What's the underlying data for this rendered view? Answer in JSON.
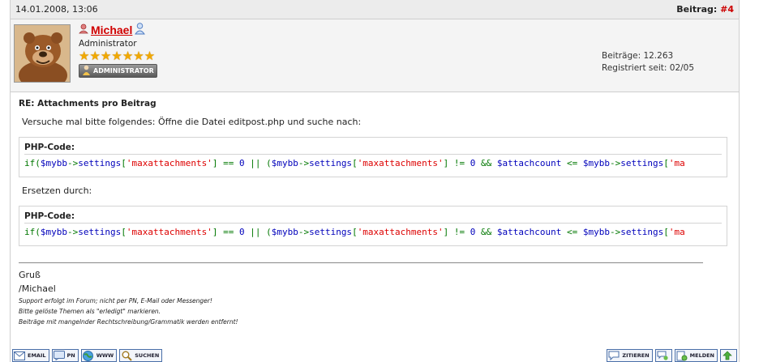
{
  "post": {
    "date": "14.01.2008, 13:06",
    "label": "Beitrag:",
    "number": "#4"
  },
  "author": {
    "name": "Michael",
    "title": "Administrator",
    "stars": 7,
    "badge": "ADMINISTRATOR",
    "posts": "Beiträge: 12.263",
    "registered": "Registriert seit: 02/05"
  },
  "message": {
    "subject": "RE: Attachments pro Beitrag",
    "intro": "Versuche mal bitte folgendes: Öffne die Datei editpost.php und suche nach:",
    "code_title_1": "PHP-Code:",
    "replace_text": "Ersetzen durch:",
    "code_title_2": "PHP-Code:",
    "code_line_1": [
      {
        "t": "if(",
        "c": "c-green"
      },
      {
        "t": "$mybb",
        "c": "c-blue"
      },
      {
        "t": "->",
        "c": "c-green"
      },
      {
        "t": "settings",
        "c": "c-blue"
      },
      {
        "t": "[",
        "c": "c-green"
      },
      {
        "t": "'maxattachments'",
        "c": "c-red"
      },
      {
        "t": "] == ",
        "c": "c-green"
      },
      {
        "t": "0 ",
        "c": "c-blue"
      },
      {
        "t": "|| (",
        "c": "c-green"
      },
      {
        "t": "$mybb",
        "c": "c-blue"
      },
      {
        "t": "->",
        "c": "c-green"
      },
      {
        "t": "settings",
        "c": "c-blue"
      },
      {
        "t": "[",
        "c": "c-green"
      },
      {
        "t": "'maxattachments'",
        "c": "c-red"
      },
      {
        "t": "] != ",
        "c": "c-green"
      },
      {
        "t": "0 ",
        "c": "c-blue"
      },
      {
        "t": "&& ",
        "c": "c-green"
      },
      {
        "t": "$attachcount ",
        "c": "c-blue"
      },
      {
        "t": "<= ",
        "c": "c-green"
      },
      {
        "t": "$mybb",
        "c": "c-blue"
      },
      {
        "t": "->",
        "c": "c-green"
      },
      {
        "t": "settings",
        "c": "c-blue"
      },
      {
        "t": "[",
        "c": "c-green"
      },
      {
        "t": "'ma",
        "c": "c-red"
      }
    ],
    "code_line_2": [
      {
        "t": "if(",
        "c": "c-green"
      },
      {
        "t": "$mybb",
        "c": "c-blue"
      },
      {
        "t": "->",
        "c": "c-green"
      },
      {
        "t": "settings",
        "c": "c-blue"
      },
      {
        "t": "[",
        "c": "c-green"
      },
      {
        "t": "'maxattachments'",
        "c": "c-red"
      },
      {
        "t": "] == ",
        "c": "c-green"
      },
      {
        "t": "0 ",
        "c": "c-blue"
      },
      {
        "t": "|| (",
        "c": "c-green"
      },
      {
        "t": "$mybb",
        "c": "c-blue"
      },
      {
        "t": "->",
        "c": "c-green"
      },
      {
        "t": "settings",
        "c": "c-blue"
      },
      {
        "t": "[",
        "c": "c-green"
      },
      {
        "t": "'maxattachments'",
        "c": "c-red"
      },
      {
        "t": "] != ",
        "c": "c-green"
      },
      {
        "t": "0 ",
        "c": "c-blue"
      },
      {
        "t": "&& ",
        "c": "c-green"
      },
      {
        "t": "$attachcount ",
        "c": "c-blue"
      },
      {
        "t": "<= ",
        "c": "c-green"
      },
      {
        "t": "$mybb",
        "c": "c-blue"
      },
      {
        "t": "->",
        "c": "c-green"
      },
      {
        "t": "settings",
        "c": "c-blue"
      },
      {
        "t": "[",
        "c": "c-green"
      },
      {
        "t": "'ma",
        "c": "c-red"
      }
    ]
  },
  "signature": {
    "greeting": "Gruß",
    "name": "/Michael",
    "line1": "Support erfolgt im Forum; nicht per PN, E-Mail oder Messenger!",
    "line2": "Bitte gelöste Themen als \"erledigt\" markieren.",
    "line3": "Beiträge mit mangelnder Rechtschreibung/Grammatik werden entfernt!"
  },
  "buttons": {
    "email": "EMAIL",
    "pm": "PN",
    "www": "WWW",
    "search": "SUCHEN",
    "quote": "ZITIEREN",
    "report": "MELDEN"
  },
  "colors": {
    "username": "#d00000",
    "post_number": "#cc0000",
    "stars": "#f0a800"
  }
}
